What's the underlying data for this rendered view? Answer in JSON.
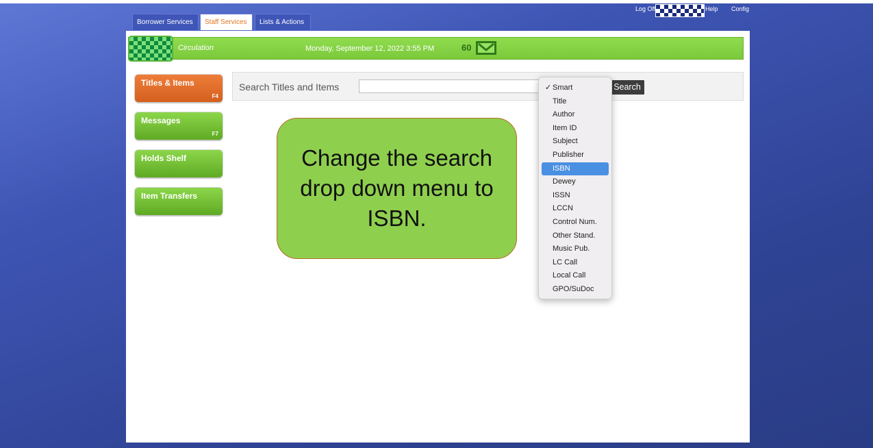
{
  "top_links": {
    "log_off": "Log Off",
    "help": "Help",
    "config": "Config"
  },
  "tabs": [
    {
      "label": "Borrower Services"
    },
    {
      "label": "Staff Services"
    },
    {
      "label": "Lists & Actions"
    }
  ],
  "circulation": {
    "label": "Circulation",
    "datetime": "Monday, September 12, 2022 3:55 PM",
    "message_count": "60"
  },
  "sidebar": {
    "items": [
      {
        "label": "Titles & Items",
        "key": "F4"
      },
      {
        "label": "Messages",
        "key": "F7"
      },
      {
        "label": "Holds Shelf",
        "key": ""
      },
      {
        "label": "Item Transfers",
        "key": ""
      }
    ]
  },
  "search": {
    "label": "Search Titles and Items",
    "value": "",
    "button_label": "Search"
  },
  "dropdown": {
    "checked": "Smart",
    "highlighted": "ISBN",
    "options": [
      "Smart",
      "Title",
      "Author",
      "Item ID",
      "Subject",
      "Publisher",
      "ISBN",
      "Dewey",
      "ISSN",
      "LCCN",
      "Control Num.",
      "Other Stand.",
      "Music Pub.",
      "LC Call",
      "Local Call",
      "GPO/SuDoc"
    ]
  },
  "callout": {
    "text": "Change the search drop down menu to ISBN."
  },
  "colors": {
    "accent_orange": "#e2731f",
    "circulation_green": "#8fdc4f",
    "selection_blue": "#4a90e2",
    "background_blue": "#3e55b4"
  }
}
